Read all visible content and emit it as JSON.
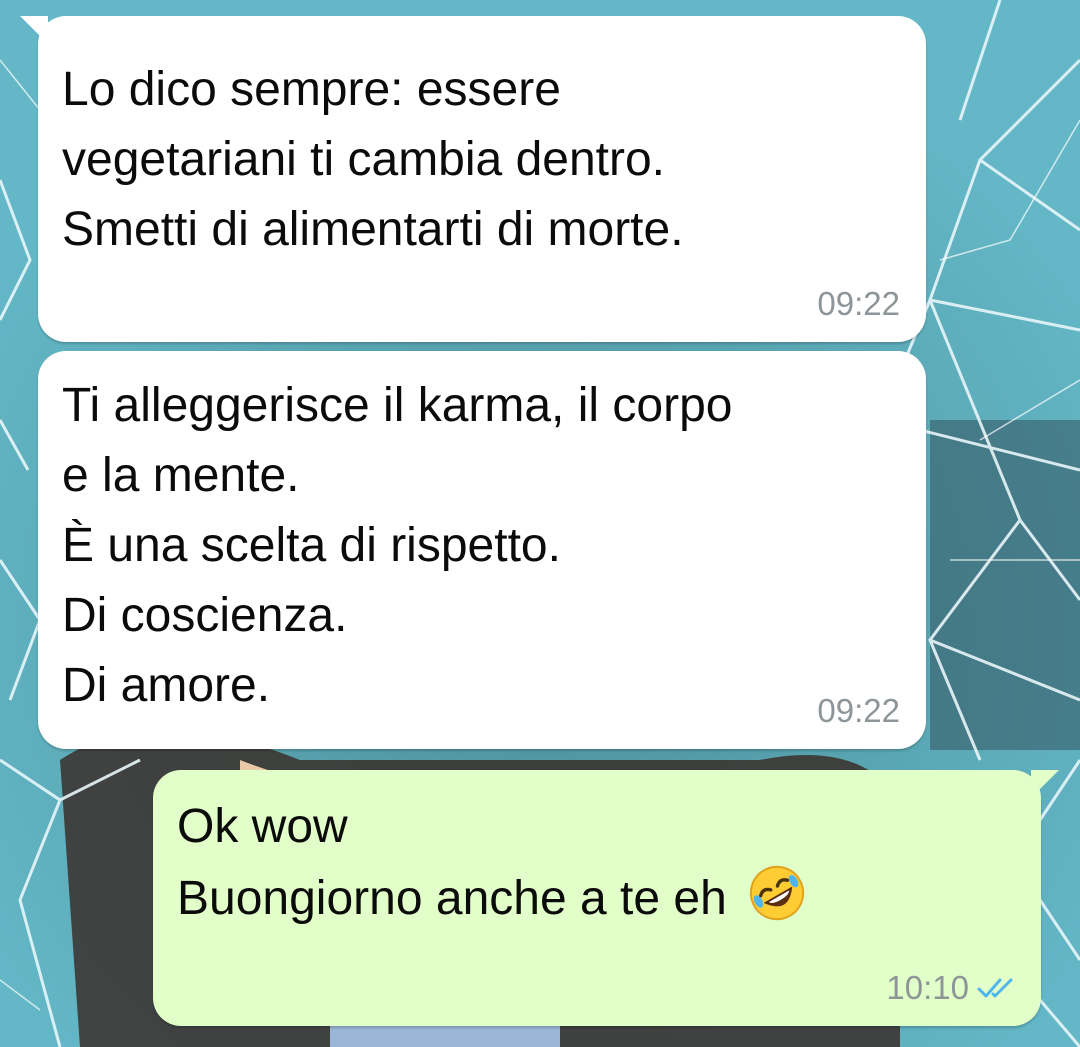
{
  "chat": {
    "wallpaper": {
      "description_icon": "cracked-glass-wallpaper",
      "base_color": "#5fb1c0"
    },
    "messages": [
      {
        "direction": "incoming",
        "text": "Lo dico sempre: essere\nvegetariani ti cambia dentro.\nSmetti di alimentarti di morte.",
        "time": "09:22"
      },
      {
        "direction": "incoming",
        "text": "Ti alleggerisce il karma, il corpo\ne la mente.\nÈ una scelta di rispetto.\nDi coscienza.\nDi amore.",
        "time": "09:22"
      },
      {
        "direction": "outgoing",
        "text_line1": "Ok wow",
        "text_line2": "Buongiorno anche a te eh",
        "emoji": "rolling-on-the-floor-laughing-icon",
        "time": "10:10",
        "status_icon": "double-check-read-icon",
        "status_color": "#4fb6ec"
      }
    ],
    "colors": {
      "incoming_bubble": "#ffffff",
      "outgoing_bubble": "#e2ffc9",
      "timestamp": "#8e9598"
    }
  }
}
